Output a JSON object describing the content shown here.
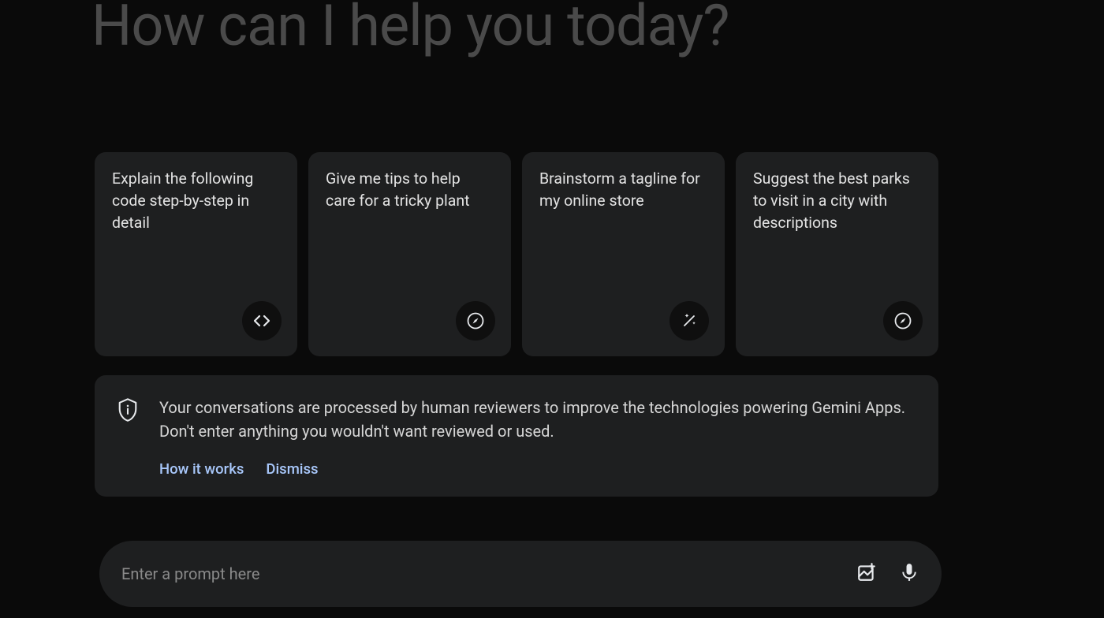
{
  "heading": "How can I help you today?",
  "cards": [
    {
      "text": "Explain the following code step-by-step in detail",
      "icon": "code"
    },
    {
      "text": "Give me tips to help care for a tricky plant",
      "icon": "compass"
    },
    {
      "text": "Brainstorm a tagline for my online store",
      "icon": "wand"
    },
    {
      "text": "Suggest the best parks to visit in a city with descriptions",
      "icon": "compass"
    }
  ],
  "notice": {
    "text": "Your conversations are processed by human reviewers to improve the technologies powering Gemini Apps. Don't enter anything you wouldn't want reviewed or used.",
    "how_it_works": "How it works",
    "dismiss": "Dismiss"
  },
  "prompt": {
    "placeholder": "Enter a prompt here"
  }
}
